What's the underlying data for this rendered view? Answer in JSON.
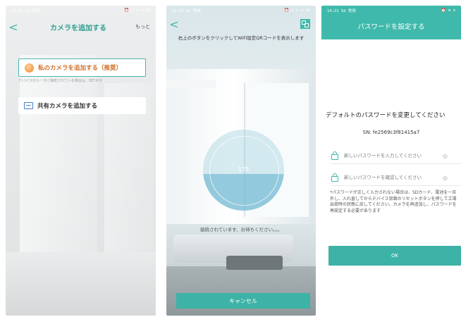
{
  "phone1": {
    "status": {
      "time": "11:30 5d 常用",
      "right": "⏰ ⊕ ⊙ ⌂ 90"
    },
    "header": {
      "back": "<",
      "title": "カメラを追加する",
      "more": "もっと"
    },
    "recommended_label": "私のカメラを追加する（推奨）",
    "hint": "デバイスがルータに接続されている場合は、SETボタ",
    "shared_label": "共有カメラを追加する"
  },
  "phone2": {
    "status": {
      "time": "11:31 5d 常用",
      "right": "⏰ ⊕ ⊙ ⌂ 90"
    },
    "header": {
      "back": "<"
    },
    "instruction": "右上のボタンをクリックしてWiFi設定QRコードを表示します",
    "countdown": "178",
    "progress": 0.45,
    "waiting": "接続されています、お待ちください。。。",
    "cancel_label": "キャンセル"
  },
  "phone3": {
    "status": {
      "time": "14:21 5d 常用",
      "right": "⏰ ⊕ ⊙"
    },
    "title": "パスワードを設定する",
    "heading": "デフォルトのパスワードを変更してください",
    "sn": "SN: fe2569c3f81415a7",
    "pw_new_placeholder": "新しいパスワードを入力してください",
    "pw_confirm_placeholder": "新しいパスワードを確認してください",
    "note": "*パスワードが正しく入力されない場合は、SDカード、電池を一旦外し、入れ直してからデバイス背面のリセットボタンを押して工場出荷時の状態に戻してください。カメラを再追加し、パスワードを再設定する必要があります",
    "ok_label": "OK"
  },
  "colors": {
    "accent": "#3fb9ab",
    "orange_text": "#d2712b"
  }
}
